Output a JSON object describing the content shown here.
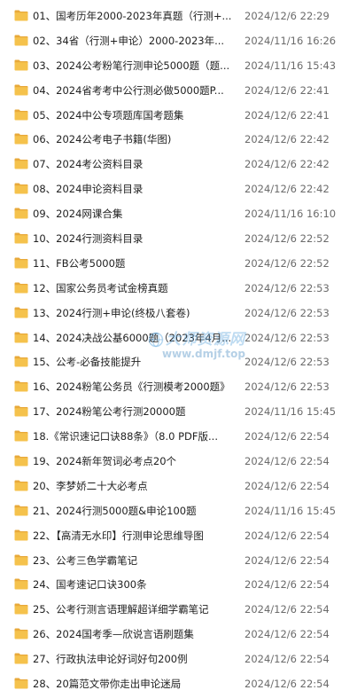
{
  "colors": {
    "folder_body": "#f5c24c",
    "folder_tab": "#e8a93a",
    "name_text": "#222222",
    "date_text": "#6b6b6b",
    "watermark": "#6eafe1"
  },
  "files": [
    {
      "icon": "folder-icon",
      "name": "01、国考历年2000-2023年真题（行测+...",
      "date": "2024/12/6 22:29"
    },
    {
      "icon": "folder-icon",
      "name": "02、34省（行测+申论）2000-2023年...",
      "date": "2024/11/16 16:26"
    },
    {
      "icon": "folder-icon",
      "name": "03、2024公考粉笔行测申论5000题（题...",
      "date": "2024/11/16 15:43"
    },
    {
      "icon": "folder-icon",
      "name": "04、2024省考考中公行测必做5000题P...",
      "date": "2024/12/6 22:41"
    },
    {
      "icon": "folder-icon",
      "name": "05、2024中公专项题库国考题集",
      "date": "2024/12/6 22:41"
    },
    {
      "icon": "folder-icon",
      "name": "06、2024公考电子书籍(华图)",
      "date": "2024/12/6 22:42"
    },
    {
      "icon": "folder-icon",
      "name": "07、2024考公资料目录",
      "date": "2024/12/6 22:42"
    },
    {
      "icon": "folder-icon",
      "name": "08、2024申论资料目录",
      "date": "2024/12/6 22:42"
    },
    {
      "icon": "folder-icon",
      "name": "09、2024网课合集",
      "date": "2024/11/16 16:10"
    },
    {
      "icon": "folder-icon",
      "name": "10、2024行测资料目录",
      "date": "2024/12/6 22:52"
    },
    {
      "icon": "folder-icon",
      "name": "11、FB公考5000题",
      "date": "2024/12/6 22:52"
    },
    {
      "icon": "folder-icon",
      "name": "12、国家公务员考试金榜真题",
      "date": "2024/12/6 22:53"
    },
    {
      "icon": "folder-icon",
      "name": "13、2024行测+申论(终极八套卷)",
      "date": "2024/12/6 22:53"
    },
    {
      "icon": "folder-icon",
      "name": "14、2024决战公基6000题（2023年4月...",
      "date": "2024/12/6 22:53"
    },
    {
      "icon": "folder-icon",
      "name": "15、公考-必备技能提升",
      "date": "2024/12/6 22:53"
    },
    {
      "icon": "folder-icon",
      "name": "16、2024粉笔公务员《行测模考2000题》",
      "date": "2024/12/6 22:53"
    },
    {
      "icon": "folder-icon",
      "name": "17、2024粉笔公考行测20000题",
      "date": "2024/11/16 15:45"
    },
    {
      "icon": "folder-icon",
      "name": "18.《常识速记口诀88条》（8.0 PDF版...",
      "date": "2024/12/6 22:54"
    },
    {
      "icon": "folder-icon",
      "name": "19、2024新年贺词必考点20个",
      "date": "2024/12/6 22:54"
    },
    {
      "icon": "folder-icon",
      "name": "20、李梦娇二十大必考点",
      "date": "2024/12/6 22:54"
    },
    {
      "icon": "folder-icon",
      "name": "21、2024行测5000题&申论100题",
      "date": "2024/11/16 15:45"
    },
    {
      "icon": "folder-icon",
      "name": "22、【高清无水印】行测申论思维导图",
      "date": "2024/12/6 22:54"
    },
    {
      "icon": "folder-icon",
      "name": "23、公考三色学霸笔记",
      "date": "2024/12/6 22:54"
    },
    {
      "icon": "folder-icon",
      "name": "24、国考速记口诀300条",
      "date": "2024/12/6 22:54"
    },
    {
      "icon": "folder-icon",
      "name": "25、公考行测言语理解超详细学霸笔记",
      "date": "2024/12/6 22:54"
    },
    {
      "icon": "folder-icon",
      "name": "26、2024国考季—欣说言语刷题集",
      "date": "2024/12/6 22:54"
    },
    {
      "icon": "folder-icon",
      "name": "27、行政执法申论好词好句200例",
      "date": "2024/12/6 22:54"
    },
    {
      "icon": "folder-icon",
      "name": "28、20篇范文带你走出申论迷局",
      "date": "2024/12/6 22:54"
    }
  ],
  "watermark": {
    "title": "大师资源网",
    "url": "www.dmjf.top"
  }
}
